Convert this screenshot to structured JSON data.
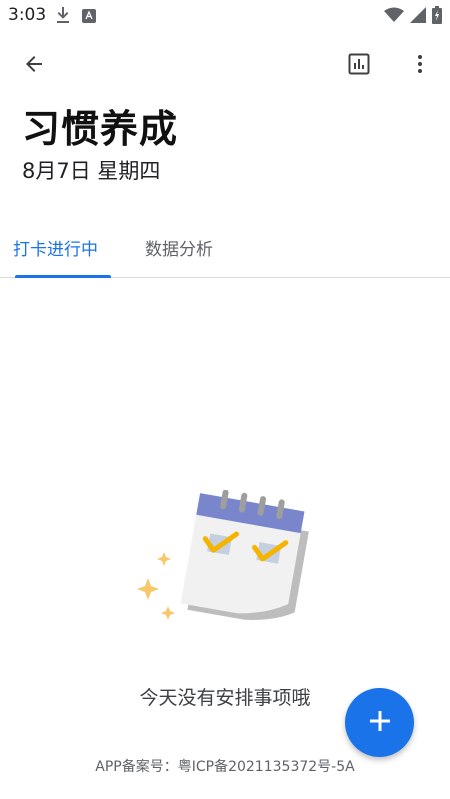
{
  "status_bar": {
    "time": "3:03",
    "left_icons": [
      "download-icon",
      "android-icon"
    ],
    "right_icons": [
      "wifi-icon",
      "signal-icon",
      "battery-icon"
    ]
  },
  "app_bar": {
    "back_icon": "arrow-back-icon",
    "actions": [
      "bar-chart-icon",
      "more-vert-icon"
    ]
  },
  "header": {
    "title": "习惯养成",
    "date": "8月7日 星期四"
  },
  "tabs": [
    {
      "label": "打卡进行中",
      "active": true
    },
    {
      "label": "数据分析",
      "active": false
    }
  ],
  "empty_state": {
    "message": "今天没有安排事项哦",
    "illustration": "calendar-check-illustration"
  },
  "footer": {
    "icp": "APP备案号：粤ICP备2021135372号-5A"
  },
  "fab": {
    "icon": "plus-icon"
  },
  "colors": {
    "accent": "#1a73e8",
    "calendar_header": "#7986cb",
    "check": "#f4b400"
  }
}
